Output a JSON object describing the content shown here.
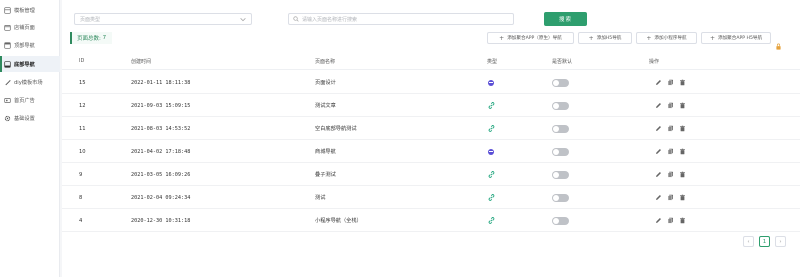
{
  "sidebar": {
    "items": [
      {
        "label": "模板管理",
        "icon": "template-icon",
        "active": false
      },
      {
        "label": "店铺页面",
        "icon": "page-icon",
        "active": false
      },
      {
        "label": "顶部导航",
        "icon": "top-nav-icon",
        "active": false
      },
      {
        "label": "底部导航",
        "icon": "bottom-nav-icon",
        "active": true
      },
      {
        "label": "diy模板市场",
        "icon": "brush-icon",
        "active": false
      },
      {
        "label": "首页广告",
        "icon": "ad-icon",
        "active": false
      },
      {
        "label": "基础设置",
        "icon": "gear-icon",
        "active": false
      }
    ]
  },
  "filters": {
    "type_select_placeholder": "页面类型",
    "search_placeholder": "请输入页面名称进行搜索",
    "search_button": "搜索"
  },
  "toolbar": {
    "total_label": "页面总数:",
    "total_count": "7",
    "add_buttons": [
      "添加聚合APP（原生）导航",
      "添加H5导航",
      "添加小程序导航",
      "添加聚合APP H5导航"
    ]
  },
  "table": {
    "headers": [
      "ID",
      "创建时间",
      "页面名称",
      "类型",
      "是否默认",
      "操作"
    ],
    "rows": [
      {
        "id": "15",
        "created": "2022-01-11 18:11:38",
        "name": "页面设计",
        "type": "native-nav",
        "is_default": false
      },
      {
        "id": "12",
        "created": "2021-09-03 15:09:15",
        "name": "测试文章",
        "type": "link",
        "is_default": false
      },
      {
        "id": "11",
        "created": "2021-08-03 14:53:52",
        "name": "空白底部导航测试",
        "type": "link",
        "is_default": false
      },
      {
        "id": "10",
        "created": "2021-04-02 17:18:48",
        "name": "商城导航",
        "type": "native-nav",
        "is_default": false
      },
      {
        "id": "9",
        "created": "2021-03-05 16:09:26",
        "name": "叠子测试",
        "type": "link",
        "is_default": false
      },
      {
        "id": "8",
        "created": "2021-02-04 09:24:34",
        "name": "测试",
        "type": "link",
        "is_default": false
      },
      {
        "id": "4",
        "created": "2020-12-30 10:31:18",
        "name": "小程序导航（全栈）",
        "type": "link",
        "is_default": false
      }
    ]
  },
  "pagination": {
    "prev": "‹",
    "current": "1",
    "next": "›"
  },
  "colors": {
    "accent": "#2e9e6e",
    "nav_type": "#5b4fd6",
    "link_type": "#1aa37a",
    "toggle_off": "#bfc2c7"
  }
}
